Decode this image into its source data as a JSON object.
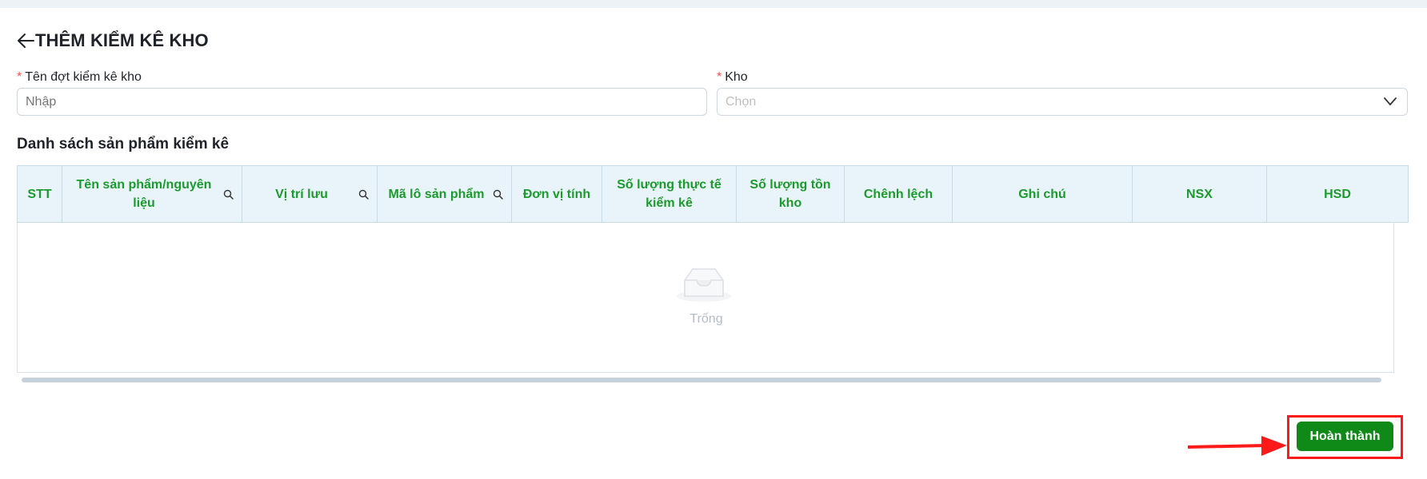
{
  "header": {
    "title": "THÊM KIỂM KÊ KHO",
    "back_icon": "arrow-left-icon"
  },
  "form": {
    "name_field": {
      "label": "Tên đợt kiểm kê kho",
      "required_mark": "*",
      "placeholder": "Nhập"
    },
    "warehouse_field": {
      "label": "Kho",
      "required_mark": "*",
      "placeholder": "Chọn"
    }
  },
  "section": {
    "title": "Danh sách sản phẩm kiểm kê"
  },
  "table": {
    "columns": [
      {
        "label": "STT"
      },
      {
        "label": "Tên sản phẩm/nguyên liệu",
        "search": true
      },
      {
        "label": "Vị trí lưu",
        "search": true
      },
      {
        "label": "Mã lô sản phẩm",
        "search": true
      },
      {
        "label": "Đơn vị tính"
      },
      {
        "label": "Số lượng thực tế kiểm kê"
      },
      {
        "label": "Số lượng tồn kho"
      },
      {
        "label": "Chênh lệch"
      },
      {
        "label": "Ghi chú"
      },
      {
        "label": "NSX"
      },
      {
        "label": "HSD"
      }
    ],
    "empty_text": "Trống",
    "header_text_color": "#1b9a2d"
  },
  "footer": {
    "done_label": "Hoàn thành",
    "done_color": "#0f8a18",
    "highlight_color": "#ff1a1a"
  }
}
